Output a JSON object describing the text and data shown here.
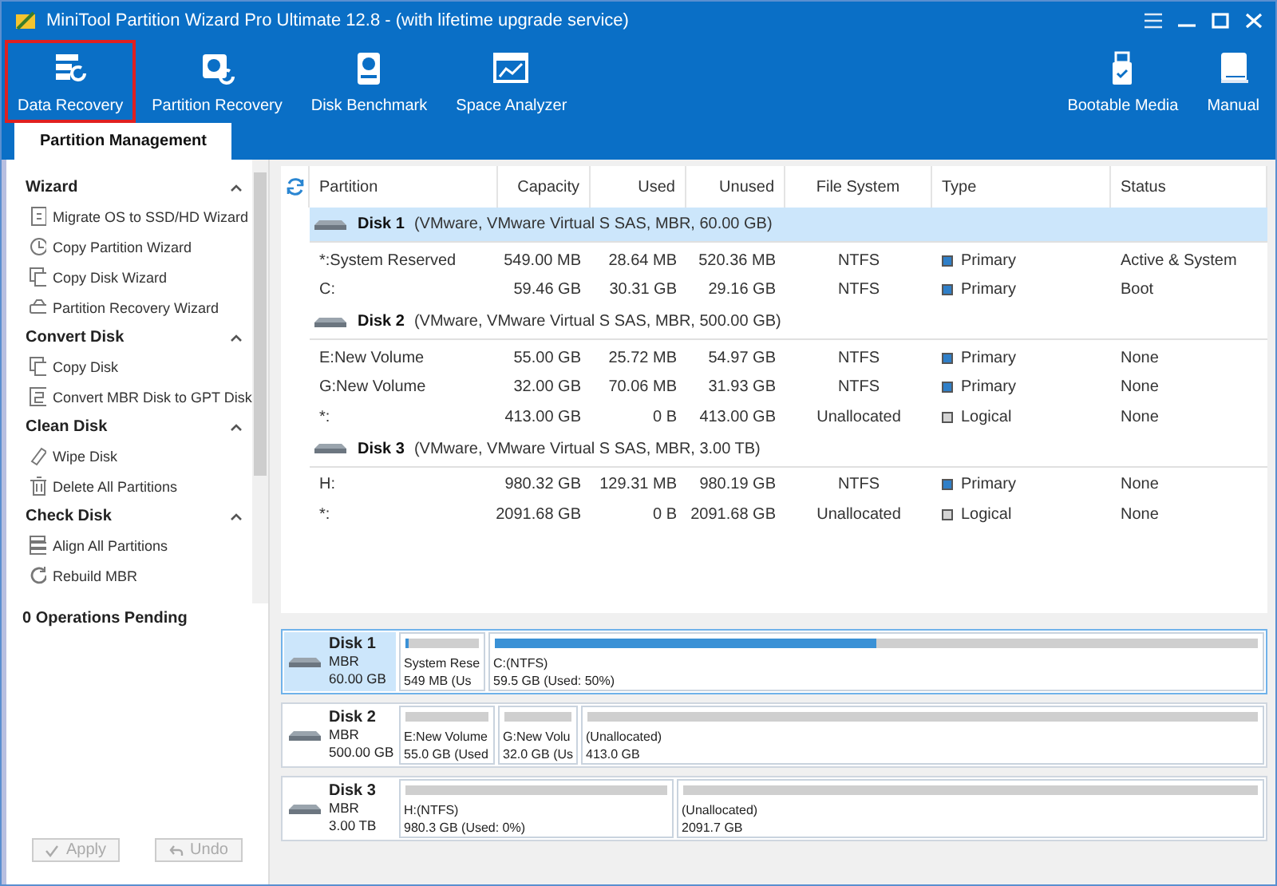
{
  "window": {
    "title": "MiniTool Partition Wizard Pro Ultimate 12.8 - (with lifetime upgrade service)"
  },
  "toolbar": {
    "left": [
      {
        "label": "Data Recovery",
        "highlighted": true
      },
      {
        "label": "Partition Recovery",
        "highlighted": false
      },
      {
        "label": "Disk Benchmark",
        "highlighted": false
      },
      {
        "label": "Space Analyzer",
        "highlighted": false
      }
    ],
    "right": [
      {
        "label": "Bootable Media",
        "highlighted": false
      },
      {
        "label": "Manual",
        "highlighted": false
      }
    ]
  },
  "tabs": [
    {
      "label": "Partition Management",
      "selected": true
    }
  ],
  "sidebar": {
    "sections": [
      {
        "title": "Wizard",
        "expanded": true,
        "items": [
          "Migrate OS to SSD/HD Wizard",
          "Copy Partition Wizard",
          "Copy Disk Wizard",
          "Partition Recovery Wizard"
        ]
      },
      {
        "title": "Convert Disk",
        "expanded": true,
        "items": [
          "Copy Disk",
          "Convert MBR Disk to GPT Disk"
        ]
      },
      {
        "title": "Clean Disk",
        "expanded": true,
        "items": [
          "Wipe Disk",
          "Delete All Partitions"
        ]
      },
      {
        "title": "Check Disk",
        "expanded": true,
        "items": [
          "Align All Partitions",
          "Rebuild MBR"
        ]
      }
    ],
    "pending": "0 Operations Pending",
    "buttons": [
      {
        "label": "Apply",
        "disabled": true
      },
      {
        "label": "Undo",
        "disabled": true
      }
    ]
  },
  "table": {
    "columns": [
      "Partition",
      "Capacity",
      "Used",
      "Unused",
      "File System",
      "Type",
      "Status"
    ],
    "disks": [
      {
        "name": "Disk 1",
        "detail": "(VMware, VMware Virtual S SAS, MBR, 60.00 GB)",
        "selected": true,
        "partitions": [
          {
            "partition": "*:System Reserved",
            "capacity": "549.00 MB",
            "used": "28.64 MB",
            "unused": "520.36 MB",
            "file_system": "NTFS",
            "type": "Primary",
            "color": "#2f7fc8",
            "status": "Active & System"
          },
          {
            "partition": "C:",
            "capacity": "59.46 GB",
            "used": "30.31 GB",
            "unused": "29.16 GB",
            "file_system": "NTFS",
            "type": "Primary",
            "color": "#2f7fc8",
            "status": "Boot"
          }
        ]
      },
      {
        "name": "Disk 2",
        "detail": "(VMware, VMware Virtual S SAS, MBR, 500.00 GB)",
        "selected": false,
        "partitions": [
          {
            "partition": "E:New Volume",
            "capacity": "55.00 GB",
            "used": "25.72 MB",
            "unused": "54.97 GB",
            "file_system": "NTFS",
            "type": "Primary",
            "color": "#2f7fc8",
            "status": "None"
          },
          {
            "partition": "G:New Volume",
            "capacity": "32.00 GB",
            "used": "70.06 MB",
            "unused": "31.93 GB",
            "file_system": "NTFS",
            "type": "Primary",
            "color": "#2f7fc8",
            "status": "None"
          },
          {
            "partition": "*:",
            "capacity": "413.00 GB",
            "used": "0 B",
            "unused": "413.00 GB",
            "file_system": "Unallocated",
            "type": "Logical",
            "color": "#d4d4d4",
            "status": "None"
          }
        ]
      },
      {
        "name": "Disk 3",
        "detail": "(VMware, VMware Virtual S SAS, MBR, 3.00 TB)",
        "selected": false,
        "partitions": [
          {
            "partition": "H:",
            "capacity": "980.32 GB",
            "used": "129.31 MB",
            "unused": "980.19 GB",
            "file_system": "NTFS",
            "type": "Primary",
            "color": "#2f7fc8",
            "status": "None"
          },
          {
            "partition": "*:",
            "capacity": "2091.68 GB",
            "used": "0 B",
            "unused": "2091.68 GB",
            "file_system": "Unallocated",
            "type": "Logical",
            "color": "#d4d4d4",
            "status": "None"
          }
        ]
      }
    ]
  },
  "disk_map": [
    {
      "name": "Disk 1",
      "scheme": "MBR",
      "size": "60.00 GB",
      "selected": true,
      "partitions": [
        {
          "label": "System Rese",
          "detail": "549 MB (Us",
          "level": 0.05
        },
        {
          "label": "C:(NTFS)",
          "detail": "59.5 GB (Used: 50%)",
          "level": 0.5
        }
      ]
    },
    {
      "name": "Disk 2",
      "scheme": "MBR",
      "size": "500.00 GB",
      "selected": false,
      "partitions": [
        {
          "label": "E:New Volume",
          "detail": "55.0 GB (Used",
          "level": 0
        },
        {
          "label": "G:New Volu",
          "detail": "32.0 GB (Us",
          "level": 0
        },
        {
          "label": "(Unallocated)",
          "detail": "413.0 GB",
          "level": 0
        }
      ]
    },
    {
      "name": "Disk 3",
      "scheme": "MBR",
      "size": "3.00 TB",
      "selected": false,
      "partitions": [
        {
          "label": "H:(NTFS)",
          "detail": "980.3 GB (Used: 0%)",
          "level": 0
        },
        {
          "label": "(Unallocated)",
          "detail": "2091.7 GB",
          "level": 0
        }
      ]
    }
  ]
}
